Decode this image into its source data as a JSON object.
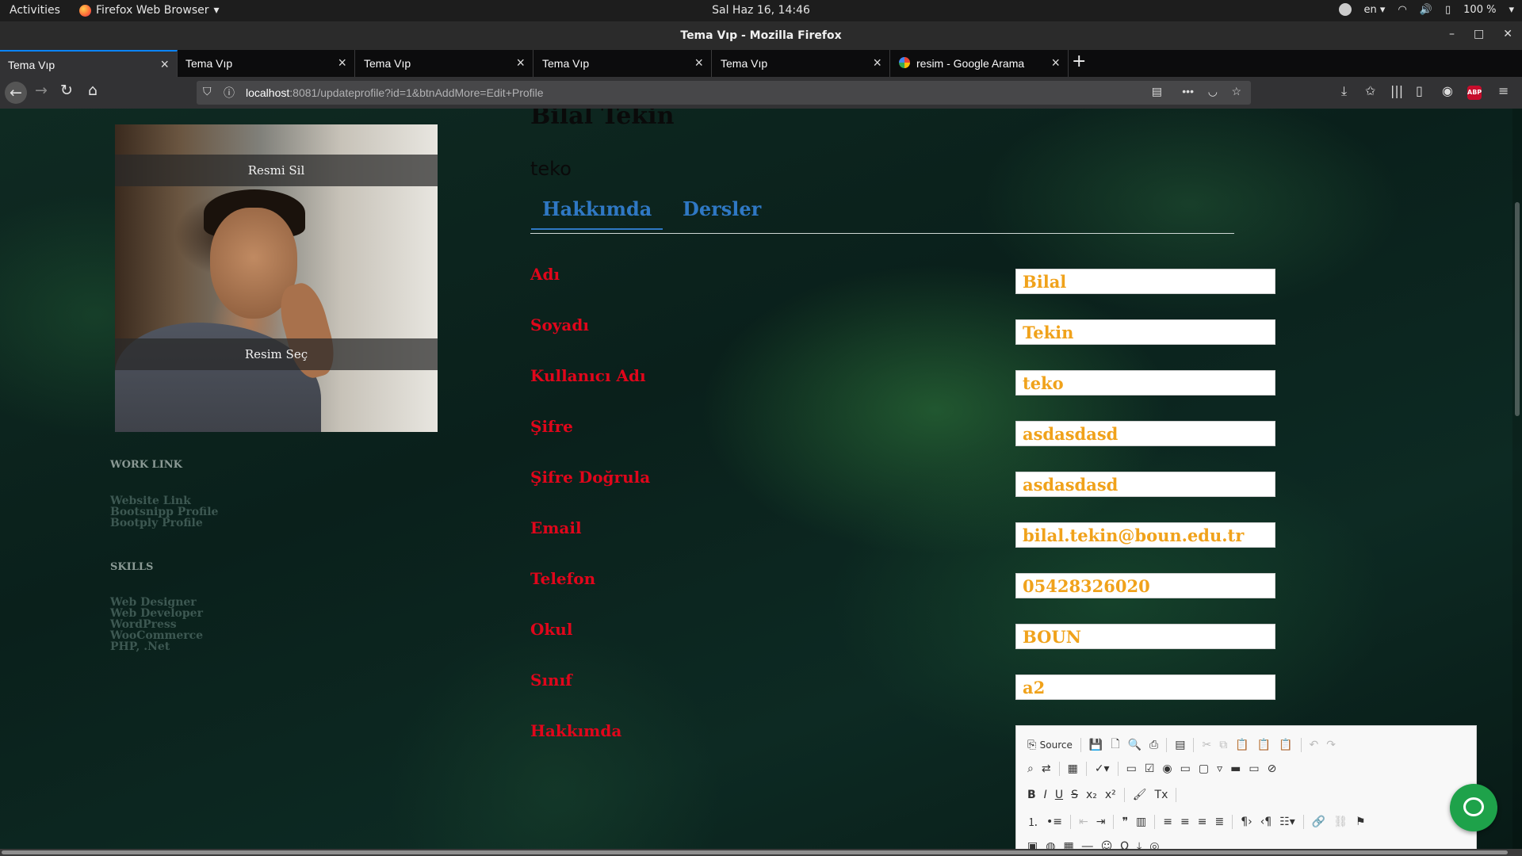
{
  "topbar": {
    "activities": "Activities",
    "app_name": "Firefox Web Browser",
    "clock": "Sal Haz 16, 14:46",
    "lang": "en",
    "battery": "100 %"
  },
  "window": {
    "title": "Tema Vıp - Mozilla Firefox"
  },
  "tabs": [
    {
      "label": "Tema Vıp"
    },
    {
      "label": "Tema Vıp"
    },
    {
      "label": "Tema Vıp"
    },
    {
      "label": "Tema Vıp"
    },
    {
      "label": "Tema Vıp"
    },
    {
      "label": "resim - Google Arama"
    }
  ],
  "url": {
    "host": "localhost",
    "rest": ":8081/updateprofile?id=1&btnAddMore=Edit+Profile"
  },
  "sidebar": {
    "remove_photo": "Resmi Sil",
    "choose_photo": "Resim Seç",
    "work_link_title": "WORK LINK",
    "work_links": [
      "Website Link",
      "Bootsnipp Profile",
      "Bootply Profile"
    ],
    "skills_title": "SKILLS",
    "skills": [
      "Web Designer",
      "Web Developer",
      "WordPress",
      "WooCommerce",
      "PHP, .Net"
    ]
  },
  "profile": {
    "name": "Bilal Tekin",
    "username": "teko",
    "tabs": [
      "Hakkımda",
      "Dersler"
    ]
  },
  "form": {
    "fields": [
      {
        "label": "Adı",
        "value": "Bilal"
      },
      {
        "label": "Soyadı",
        "value": "Tekin"
      },
      {
        "label": "Kullanıcı Adı",
        "value": "teko"
      },
      {
        "label": "Şifre",
        "value": "asdasdasd"
      },
      {
        "label": "Şifre Doğrula",
        "value": "asdasdasd"
      },
      {
        "label": "Email",
        "value": "bilal.tekin@boun.edu.tr"
      },
      {
        "label": "Telefon",
        "value": "05428326020"
      },
      {
        "label": "Okul",
        "value": "BOUN"
      },
      {
        "label": "Sınıf",
        "value": "a2"
      }
    ],
    "about_label": "Hakkımda",
    "editor_source": "Source"
  },
  "colors": {
    "label": "#e0061b",
    "input_text": "#f0a21b",
    "tab_accent": "#2f78c4",
    "chat": "#1ea24a"
  }
}
